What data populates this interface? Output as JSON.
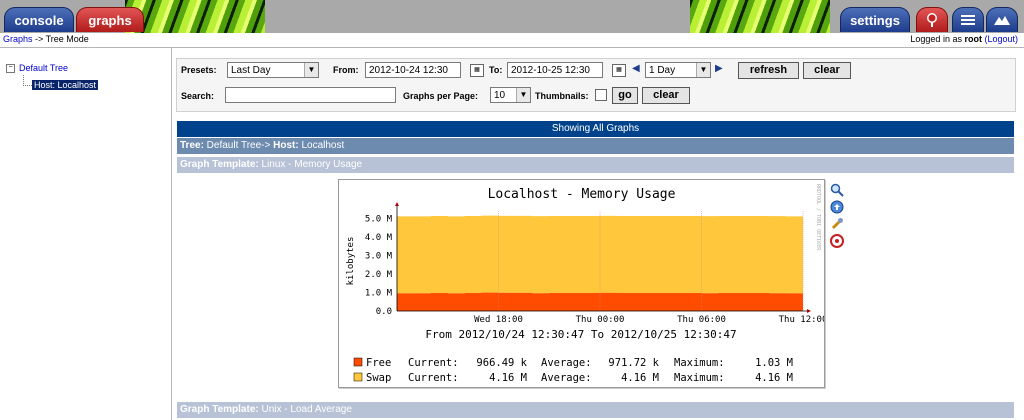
{
  "tabs": {
    "console": "console",
    "graphs": "graphs",
    "settings": "settings"
  },
  "breadcrumb": {
    "link": "Graphs",
    "rest": " -> Tree Mode"
  },
  "login": {
    "prefix": "Logged in as ",
    "user": "root",
    "logout": "(Logout)"
  },
  "tree": {
    "root": "Default Tree",
    "host": "Host: Localhost"
  },
  "filter": {
    "presets_label": "Presets:",
    "presets_value": "Last Day",
    "from_label": "From:",
    "from_value": "2012-10-24 12:30",
    "to_label": "To:",
    "to_value": "2012-10-25 12:30",
    "span_value": "1 Day",
    "refresh": "refresh",
    "clear": "clear",
    "search_label": "Search:",
    "search_value": "",
    "gpp_label": "Graphs per Page:",
    "gpp_value": "10",
    "thumbnails_label": "Thumbnails:",
    "go": "go",
    "clear2": "clear"
  },
  "showing": "Showing All Graphs",
  "tree_bar": {
    "tree_label": "Tree:",
    "tree_value": " Default Tree-> ",
    "host_label": "Host:",
    "host_value": " Localhost"
  },
  "template1": {
    "label": "Graph Template:",
    "value": " Linux - Memory Usage"
  },
  "template2": {
    "label": "Graph Template:",
    "value": " Unix - Load Average"
  },
  "graph_side": "RRDTOOL / TOBI OETIKER",
  "chart_data": {
    "type": "area",
    "title": "Localhost - Memory Usage",
    "ylabel": "kilobytes",
    "yticks": [
      "0.0",
      "1.0 M",
      "2.0 M",
      "3.0 M",
      "4.0 M",
      "5.0 M"
    ],
    "ylim": [
      0,
      5.4
    ],
    "xticks": [
      "Wed 18:00",
      "Thu 00:00",
      "Thu 06:00",
      "Thu 12:00"
    ],
    "subtitle": "From 2012/10/24 12:30:47 To 2012/10/25 12:30:47",
    "grid": true,
    "series": [
      {
        "name": "Free",
        "color": "#ff4c00",
        "values": [
          0.95,
          0.95,
          0.97,
          0.95,
          0.97,
          0.99,
          0.98,
          0.98,
          0.96,
          0.97,
          0.97,
          0.97,
          0.98,
          0.97,
          0.97,
          0.97,
          0.97,
          0.97,
          0.96,
          0.97,
          0.97,
          0.97,
          0.96,
          0.95
        ]
      },
      {
        "name": "Swap",
        "color": "#ffc73b",
        "values": [
          4.16,
          4.16,
          4.16,
          4.16,
          4.16,
          4.16,
          4.16,
          4.16,
          4.16,
          4.16,
          4.16,
          4.16,
          4.16,
          4.16,
          4.16,
          4.16,
          4.16,
          4.16,
          4.16,
          4.16,
          4.16,
          4.16,
          4.16,
          4.16
        ]
      }
    ],
    "legend": [
      {
        "name": "Free",
        "current_label": "Current:",
        "current": "966.49 k",
        "average_label": "Average:",
        "average": "971.72 k",
        "maximum_label": "Maximum:",
        "maximum": "1.03 M"
      },
      {
        "name": "Swap",
        "current_label": "Current:",
        "current": "4.16 M",
        "average_label": "Average:",
        "average": "4.16 M",
        "maximum_label": "Maximum:",
        "maximum": "4.16 M"
      }
    ]
  }
}
